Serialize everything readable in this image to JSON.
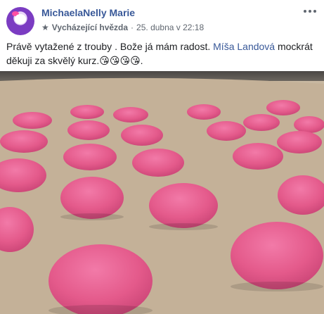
{
  "post": {
    "author": "MichaelaNelly Marie",
    "badge": "Vycházející hvězda",
    "date": "25. dubna v 22:18",
    "text_before": "Právě vytažené z trouby . Bože já mám radost. ",
    "mention": "Míša Landová",
    "text_after": " mockrát děkuji za skvělý kurz.",
    "emojis": "😘😘😘😘."
  },
  "icons": {
    "more": "more-options-icon",
    "star": "rising-star-icon",
    "sep": "·"
  },
  "colors": {
    "link": "#385898",
    "meta": "#606770",
    "macaron": "#e85b8d"
  }
}
